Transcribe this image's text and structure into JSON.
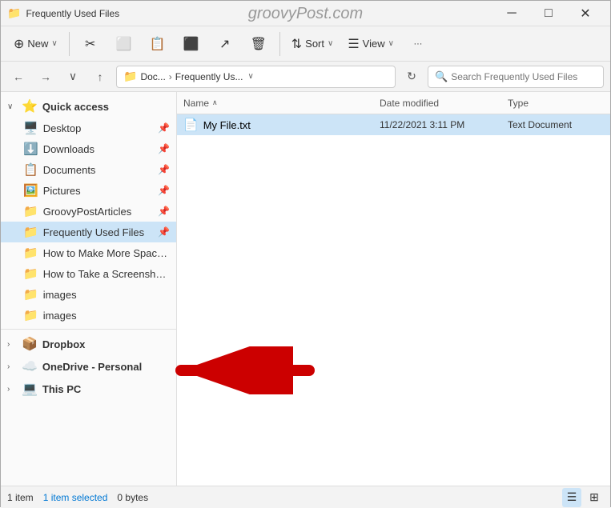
{
  "titleBar": {
    "icon": "📁",
    "title": "Frequently Used Files",
    "watermark": "groovyPost.com",
    "minimize": "─",
    "maximize": "□",
    "close": "✕"
  },
  "toolbar": {
    "new_label": "New",
    "sort_label": "Sort",
    "view_label": "View",
    "more_label": "···"
  },
  "addressBar": {
    "back": "←",
    "forward": "→",
    "down": "∨",
    "up": "↑",
    "path_icon": "📁",
    "path_part1": "Doc...",
    "path_sep": "›",
    "path_part2": "Frequently Us...",
    "refresh": "↻",
    "search_placeholder": "Search Frequently Used Files"
  },
  "fileHeader": {
    "name": "Name",
    "sort_arrow": "∧",
    "date_modified": "Date modified",
    "type": "Type"
  },
  "files": [
    {
      "icon": "📄",
      "name": "My File.txt",
      "date": "11/22/2021 3:11 PM",
      "type": "Text Document",
      "selected": true
    }
  ],
  "sidebar": {
    "quick_access_label": "Quick access",
    "quick_access_icon": "⭐",
    "expand": "∨",
    "collapse": "›",
    "items": [
      {
        "label": "Desktop",
        "icon": "🖥️",
        "pinned": true
      },
      {
        "label": "Downloads",
        "icon": "⬇️",
        "pinned": true
      },
      {
        "label": "Documents",
        "icon": "📋",
        "pinned": true
      },
      {
        "label": "Pictures",
        "icon": "🖼️",
        "pinned": true
      },
      {
        "label": "GroovyPostArticles",
        "icon": "📁",
        "pinned": true
      },
      {
        "label": "Frequently Used Files",
        "icon": "📁",
        "pinned": true,
        "active": true
      },
      {
        "label": "How to Make More Space Av",
        "icon": "📁",
        "pinned": false
      },
      {
        "label": "How to Take a Screenshot on",
        "icon": "📁",
        "pinned": false
      },
      {
        "label": "images",
        "icon": "📁",
        "pinned": false
      },
      {
        "label": "images",
        "icon": "📁",
        "pinned": false
      }
    ],
    "groups": [
      {
        "label": "Dropbox",
        "icon": "📦",
        "expand": "›"
      },
      {
        "label": "OneDrive - Personal",
        "icon": "☁️",
        "expand": "›"
      },
      {
        "label": "This PC",
        "icon": "💻",
        "expand": "›"
      }
    ]
  },
  "statusBar": {
    "count": "1 item",
    "selected": "1 item selected",
    "bytes": "0 bytes"
  }
}
